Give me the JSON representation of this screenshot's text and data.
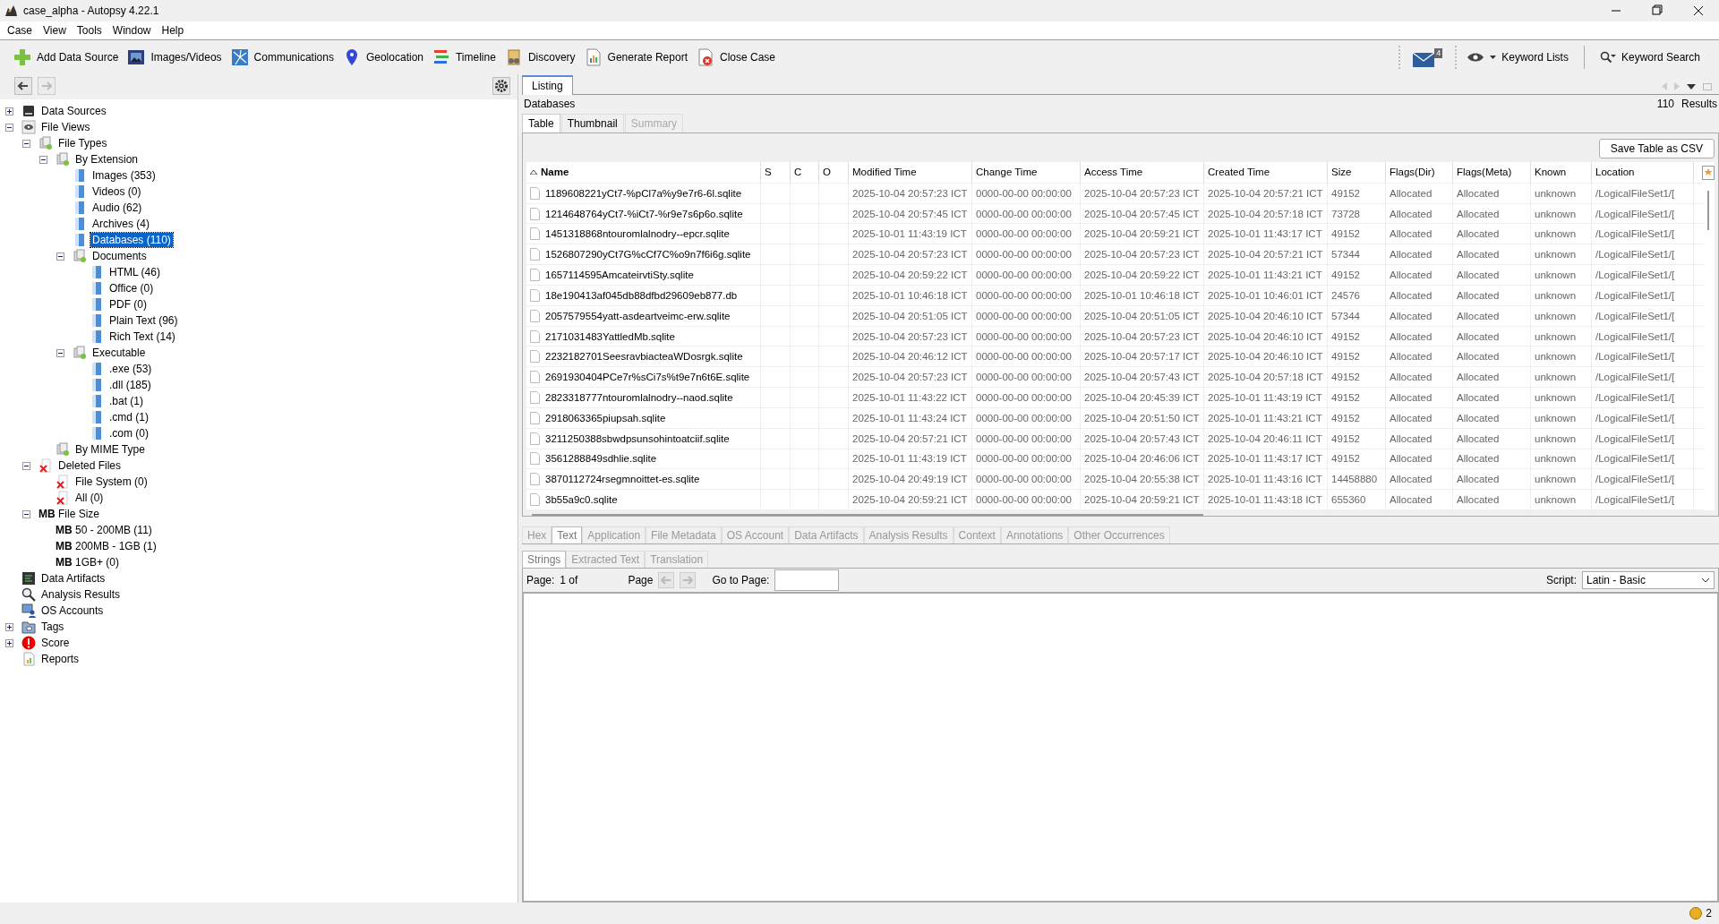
{
  "window": {
    "title": "case_alpha - Autopsy 4.22.1"
  },
  "menu": [
    "Case",
    "View",
    "Tools",
    "Window",
    "Help"
  ],
  "toolbar": {
    "items": [
      {
        "label": "Add Data Source",
        "kind": "add"
      },
      {
        "label": "Images/Videos",
        "kind": "images"
      },
      {
        "label": "Communications",
        "kind": "comms"
      },
      {
        "label": "Geolocation",
        "kind": "geo"
      },
      {
        "label": "Timeline",
        "kind": "timeline"
      },
      {
        "label": "Discovery",
        "kind": "discovery"
      },
      {
        "label": "Generate Report",
        "kind": "report"
      },
      {
        "label": "Close Case",
        "kind": "close"
      }
    ],
    "notification_count": "4",
    "keyword_lists": "Keyword Lists",
    "keyword_search": "Keyword Search"
  },
  "tree": [
    {
      "label": "Data Sources",
      "kind": "disk",
      "expanded": false,
      "selected": false
    },
    {
      "label": "File Views",
      "kind": "views",
      "expanded": true,
      "selected": false,
      "children": [
        {
          "label": "File Types",
          "kind": "filetype",
          "expanded": true,
          "selected": false,
          "children": [
            {
              "label": "By Extension",
              "kind": "filetype",
              "expanded": true,
              "selected": false,
              "children": [
                {
                  "label": "Images (353)",
                  "kind": "doc",
                  "selected": false
                },
                {
                  "label": "Videos (0)",
                  "kind": "doc",
                  "selected": false
                },
                {
                  "label": "Audio (62)",
                  "kind": "doc",
                  "selected": false
                },
                {
                  "label": "Archives (4)",
                  "kind": "doc",
                  "selected": false
                },
                {
                  "label": "Databases (110)",
                  "kind": "doc",
                  "selected": true
                },
                {
                  "label": "Documents",
                  "kind": "filetype",
                  "expanded": true,
                  "selected": false,
                  "children": [
                    {
                      "label": "HTML (46)",
                      "kind": "doc",
                      "selected": false
                    },
                    {
                      "label": "Office (0)",
                      "kind": "doc",
                      "selected": false
                    },
                    {
                      "label": "PDF (0)",
                      "kind": "doc",
                      "selected": false
                    },
                    {
                      "label": "Plain Text (96)",
                      "kind": "doc",
                      "selected": false
                    },
                    {
                      "label": "Rich Text (14)",
                      "kind": "doc",
                      "selected": false
                    }
                  ]
                },
                {
                  "label": "Executable",
                  "kind": "filetype",
                  "expanded": true,
                  "selected": false,
                  "children": [
                    {
                      "label": ".exe (53)",
                      "kind": "doc",
                      "selected": false
                    },
                    {
                      "label": ".dll (185)",
                      "kind": "doc",
                      "selected": false
                    },
                    {
                      "label": ".bat (1)",
                      "kind": "doc",
                      "selected": false
                    },
                    {
                      "label": ".cmd (1)",
                      "kind": "doc",
                      "selected": false
                    },
                    {
                      "label": ".com (0)",
                      "kind": "doc",
                      "selected": false
                    }
                  ]
                }
              ]
            },
            {
              "label": "By MIME Type",
              "kind": "filetype",
              "selected": false
            }
          ]
        },
        {
          "label": "Deleted Files",
          "kind": "deleted",
          "expanded": true,
          "selected": false,
          "children": [
            {
              "label": "File System (0)",
              "kind": "deleted",
              "selected": false
            },
            {
              "label": "All (0)",
              "kind": "deleted",
              "selected": false
            }
          ]
        },
        {
          "label": "File Size",
          "kind": "size",
          "icon_text": "MB",
          "expanded": true,
          "selected": false,
          "children": [
            {
              "label": "50 - 200MB (11)",
              "kind": "size",
              "icon_text": "MB",
              "selected": false
            },
            {
              "label": "200MB - 1GB (1)",
              "kind": "size",
              "icon_text": "MB",
              "selected": false
            },
            {
              "label": "1GB+ (0)",
              "kind": "size",
              "icon_text": "MB",
              "selected": false
            }
          ]
        }
      ]
    },
    {
      "label": "Data Artifacts",
      "kind": "artifacts",
      "selected": false
    },
    {
      "label": "Analysis Results",
      "kind": "analysis",
      "selected": false
    },
    {
      "label": "OS Accounts",
      "kind": "accounts",
      "selected": false
    },
    {
      "label": "Tags",
      "kind": "tags",
      "expanded": false,
      "selected": false
    },
    {
      "label": "Score",
      "kind": "score",
      "expanded": false,
      "selected": false
    },
    {
      "label": "Reports",
      "kind": "reports",
      "selected": false
    }
  ],
  "listing": {
    "tab": "Listing",
    "node_title": "Databases",
    "result_count": "110",
    "results_label": "Results",
    "view_tabs": [
      {
        "label": "Table",
        "selected": true,
        "disabled": false
      },
      {
        "label": "Thumbnail",
        "selected": false,
        "disabled": false
      },
      {
        "label": "Summary",
        "selected": false,
        "disabled": true
      }
    ],
    "save_button": "Save Table as CSV",
    "table": {
      "columns": [
        {
          "label": "Name",
          "sorted": true
        },
        {
          "label": "S",
          "sorted": false
        },
        {
          "label": "C",
          "sorted": false
        },
        {
          "label": "O",
          "sorted": false
        },
        {
          "label": "Modified Time",
          "sorted": false
        },
        {
          "label": "Change Time",
          "sorted": false
        },
        {
          "label": "Access Time",
          "sorted": false
        },
        {
          "label": "Created Time",
          "sorted": false
        },
        {
          "label": "Size",
          "sorted": false
        },
        {
          "label": "Flags(Dir)",
          "sorted": false
        },
        {
          "label": "Flags(Meta)",
          "sorted": false
        },
        {
          "label": "Known",
          "sorted": false
        },
        {
          "label": "Location",
          "sorted": false
        }
      ],
      "rows": [
        {
          "name": "1189608221yCt7-%pCl7a%y9e7r6-6l.sqlite",
          "modified": "2025-10-04 20:57:23 ICT",
          "change": "0000-00-00 00:00:00",
          "access": "2025-10-04 20:57:23 ICT",
          "created": "2025-10-04 20:57:21 ICT",
          "size": "49152",
          "flags_dir": "Allocated",
          "flags_meta": "Allocated",
          "known": "unknown",
          "location": "/LogicalFileSet1/["
        },
        {
          "name": "1214648764yCt7-%iCt7-%r9e7s6p6o.sqlite",
          "modified": "2025-10-04 20:57:45 ICT",
          "change": "0000-00-00 00:00:00",
          "access": "2025-10-04 20:57:45 ICT",
          "created": "2025-10-04 20:57:18 ICT",
          "size": "73728",
          "flags_dir": "Allocated",
          "flags_meta": "Allocated",
          "known": "unknown",
          "location": "/LogicalFileSet1/["
        },
        {
          "name": "1451318868ntouromlalnodry--epcr.sqlite",
          "modified": "2025-10-01 11:43:19 ICT",
          "change": "0000-00-00 00:00:00",
          "access": "2025-10-04 20:59:21 ICT",
          "created": "2025-10-01 11:43:17 ICT",
          "size": "49152",
          "flags_dir": "Allocated",
          "flags_meta": "Allocated",
          "known": "unknown",
          "location": "/LogicalFileSet1/["
        },
        {
          "name": "1526807290yCt7G%cCf7C%o9n7f6i6g.sqlite",
          "modified": "2025-10-04 20:57:23 ICT",
          "change": "0000-00-00 00:00:00",
          "access": "2025-10-04 20:57:23 ICT",
          "created": "2025-10-04 20:57:21 ICT",
          "size": "57344",
          "flags_dir": "Allocated",
          "flags_meta": "Allocated",
          "known": "unknown",
          "location": "/LogicalFileSet1/["
        },
        {
          "name": "1657114595AmcateirvtiSty.sqlite",
          "modified": "2025-10-04 20:59:22 ICT",
          "change": "0000-00-00 00:00:00",
          "access": "2025-10-04 20:59:22 ICT",
          "created": "2025-10-01 11:43:21 ICT",
          "size": "49152",
          "flags_dir": "Allocated",
          "flags_meta": "Allocated",
          "known": "unknown",
          "location": "/LogicalFileSet1/["
        },
        {
          "name": "18e190413af045db88dfbd29609eb877.db",
          "modified": "2025-10-01 10:46:18 ICT",
          "change": "0000-00-00 00:00:00",
          "access": "2025-10-01 10:46:18 ICT",
          "created": "2025-10-01 10:46:01 ICT",
          "size": "24576",
          "flags_dir": "Allocated",
          "flags_meta": "Allocated",
          "known": "unknown",
          "location": "/LogicalFileSet1/["
        },
        {
          "name": "2057579554yatt-asdeartveimc-erw.sqlite",
          "modified": "2025-10-04 20:51:05 ICT",
          "change": "0000-00-00 00:00:00",
          "access": "2025-10-04 20:51:05 ICT",
          "created": "2025-10-04 20:46:10 ICT",
          "size": "57344",
          "flags_dir": "Allocated",
          "flags_meta": "Allocated",
          "known": "unknown",
          "location": "/LogicalFileSet1/["
        },
        {
          "name": "2171031483YattledMb.sqlite",
          "modified": "2025-10-04 20:57:23 ICT",
          "change": "0000-00-00 00:00:00",
          "access": "2025-10-04 20:57:23 ICT",
          "created": "2025-10-04 20:46:10 ICT",
          "size": "49152",
          "flags_dir": "Allocated",
          "flags_meta": "Allocated",
          "known": "unknown",
          "location": "/LogicalFileSet1/["
        },
        {
          "name": "2232182701SeesravbiacteaWDosrgk.sqlite",
          "modified": "2025-10-04 20:46:12 ICT",
          "change": "0000-00-00 00:00:00",
          "access": "2025-10-04 20:57:17 ICT",
          "created": "2025-10-04 20:46:10 ICT",
          "size": "49152",
          "flags_dir": "Allocated",
          "flags_meta": "Allocated",
          "known": "unknown",
          "location": "/LogicalFileSet1/["
        },
        {
          "name": "2691930404PCe7r%sCi7s%t9e7n6t6E.sqlite",
          "modified": "2025-10-04 20:57:23 ICT",
          "change": "0000-00-00 00:00:00",
          "access": "2025-10-04 20:57:43 ICT",
          "created": "2025-10-04 20:57:18 ICT",
          "size": "49152",
          "flags_dir": "Allocated",
          "flags_meta": "Allocated",
          "known": "unknown",
          "location": "/LogicalFileSet1/["
        },
        {
          "name": "2823318777ntouromlalnodry--naod.sqlite",
          "modified": "2025-10-01 11:43:22 ICT",
          "change": "0000-00-00 00:00:00",
          "access": "2025-10-04 20:45:39 ICT",
          "created": "2025-10-01 11:43:19 ICT",
          "size": "49152",
          "flags_dir": "Allocated",
          "flags_meta": "Allocated",
          "known": "unknown",
          "location": "/LogicalFileSet1/["
        },
        {
          "name": "2918063365piupsah.sqlite",
          "modified": "2025-10-01 11:43:24 ICT",
          "change": "0000-00-00 00:00:00",
          "access": "2025-10-04 20:51:50 ICT",
          "created": "2025-10-01 11:43:21 ICT",
          "size": "49152",
          "flags_dir": "Allocated",
          "flags_meta": "Allocated",
          "known": "unknown",
          "location": "/LogicalFileSet1/["
        },
        {
          "name": "3211250388sbwdpsunsohintoatciif.sqlite",
          "modified": "2025-10-04 20:57:21 ICT",
          "change": "0000-00-00 00:00:00",
          "access": "2025-10-04 20:57:43 ICT",
          "created": "2025-10-04 20:46:11 ICT",
          "size": "49152",
          "flags_dir": "Allocated",
          "flags_meta": "Allocated",
          "known": "unknown",
          "location": "/LogicalFileSet1/["
        },
        {
          "name": "3561288849sdhlie.sqlite",
          "modified": "2025-10-01 11:43:19 ICT",
          "change": "0000-00-00 00:00:00",
          "access": "2025-10-04 20:46:06 ICT",
          "created": "2025-10-01 11:43:17 ICT",
          "size": "49152",
          "flags_dir": "Allocated",
          "flags_meta": "Allocated",
          "known": "unknown",
          "location": "/LogicalFileSet1/["
        },
        {
          "name": "3870112724rsegmnoittet-es.sqlite",
          "modified": "2025-10-04 20:49:19 ICT",
          "change": "0000-00-00 00:00:00",
          "access": "2025-10-04 20:55:38 ICT",
          "created": "2025-10-01 11:43:16 ICT",
          "size": "14458880",
          "flags_dir": "Allocated",
          "flags_meta": "Allocated",
          "known": "unknown",
          "location": "/LogicalFileSet1/["
        },
        {
          "name": "3b55a9c0.sqlite",
          "modified": "2025-10-04 20:59:21 ICT",
          "change": "0000-00-00 00:00:00",
          "access": "2025-10-04 20:59:21 ICT",
          "created": "2025-10-01 11:43:18 ICT",
          "size": "655360",
          "flags_dir": "Allocated",
          "flags_meta": "Allocated",
          "known": "unknown",
          "location": "/LogicalFileSet1/["
        }
      ]
    }
  },
  "viewer": {
    "tabs": [
      {
        "label": "Hex",
        "selected": false
      },
      {
        "label": "Text",
        "selected": true
      },
      {
        "label": "Application",
        "selected": false
      },
      {
        "label": "File Metadata",
        "selected": false
      },
      {
        "label": "OS Account",
        "selected": false
      },
      {
        "label": "Data Artifacts",
        "selected": false
      },
      {
        "label": "Analysis Results",
        "selected": false
      },
      {
        "label": "Context",
        "selected": false
      },
      {
        "label": "Annotations",
        "selected": false
      },
      {
        "label": "Other Occurrences",
        "selected": false
      }
    ],
    "sub_tabs": [
      {
        "label": "Strings",
        "selected": true
      },
      {
        "label": "Extracted Text",
        "selected": false
      },
      {
        "label": "Translation",
        "selected": false
      }
    ],
    "page_label": "Page:",
    "page_value": "1 of",
    "page_nav_label": "Page",
    "goto_label": "Go to Page:",
    "script_label": "Script:",
    "script_value": "Latin - Basic"
  },
  "status_bar": {
    "count": "2"
  }
}
